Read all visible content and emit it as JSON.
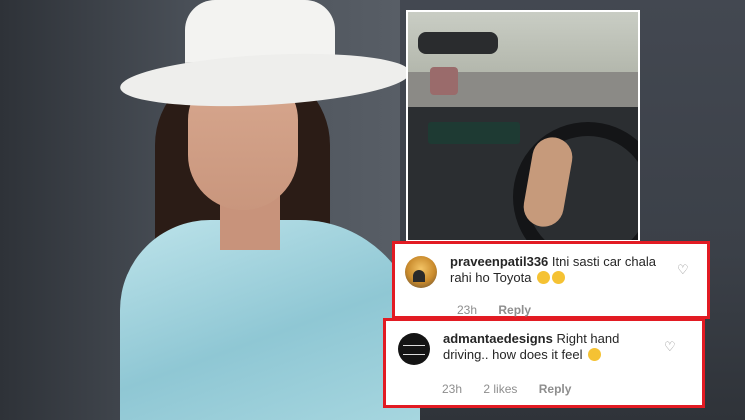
{
  "comments": [
    {
      "username": "praveenpatil336",
      "text": "Itni sasti car chala rahi ho Toyota",
      "emojis": [
        "disappointed-face",
        "disappointed-face"
      ],
      "time": "23h",
      "likes": "",
      "reply": "Reply"
    },
    {
      "username": "admantaedesigns",
      "text": "Right hand driving.. how does it feel",
      "emojis": [
        "smiling-face"
      ],
      "time": "23h",
      "likes": "2 likes",
      "reply": "Reply"
    }
  ],
  "colors": {
    "highlight_border": "#e21b23",
    "meta_text": "#8e8e8e",
    "body_text": "#262626"
  },
  "icons": [
    "heart-icon",
    "heart-icon"
  ]
}
